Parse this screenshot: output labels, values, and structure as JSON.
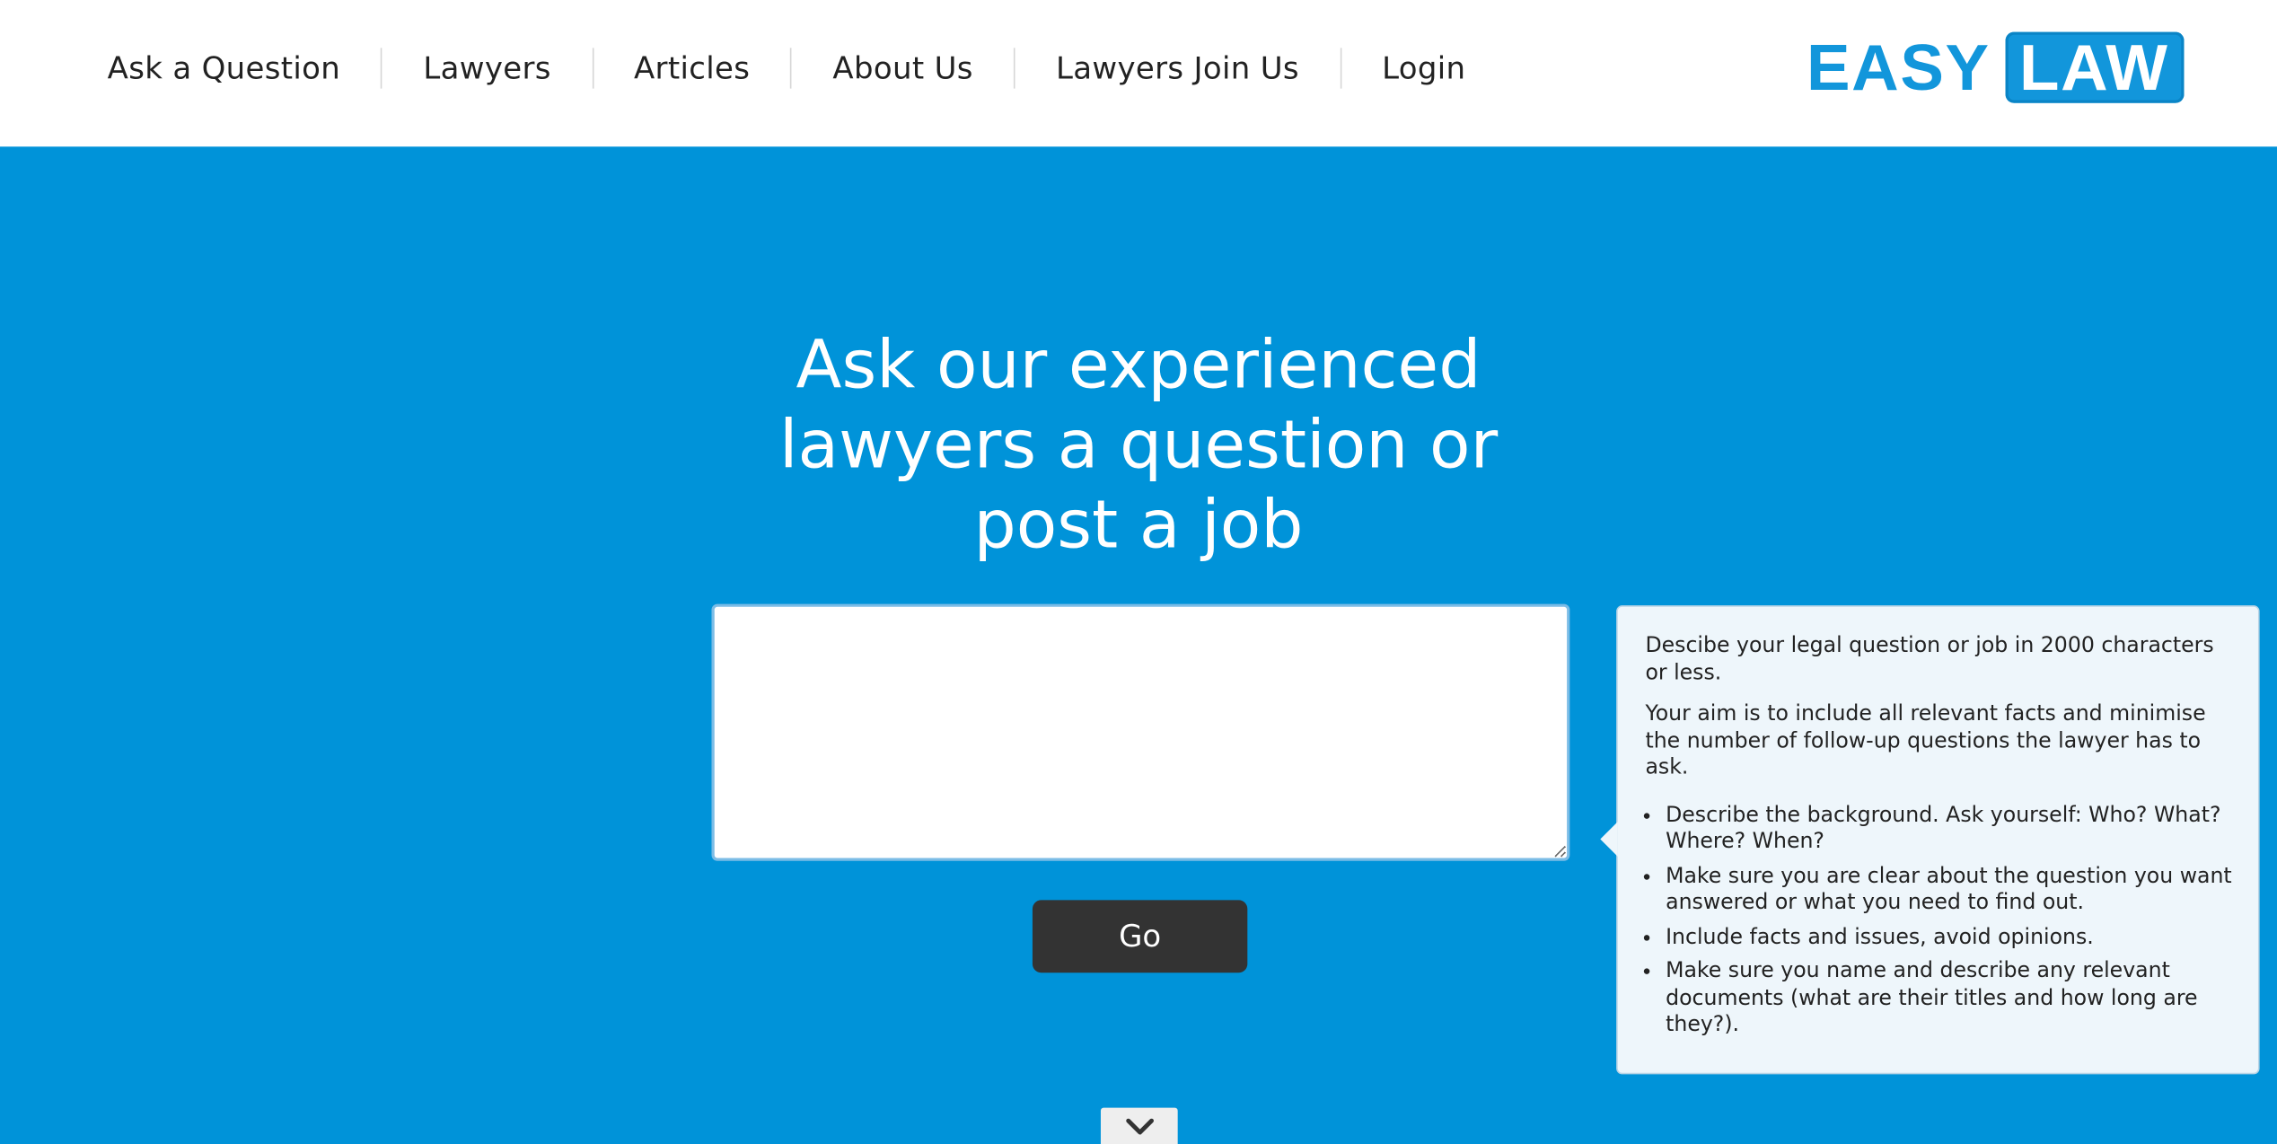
{
  "nav": {
    "items": [
      {
        "label": "Ask a Question"
      },
      {
        "label": "Lawyers"
      },
      {
        "label": "Articles"
      },
      {
        "label": "About Us"
      },
      {
        "label": "Lawyers Join Us"
      },
      {
        "label": "Login"
      }
    ]
  },
  "logo": {
    "part1": "EASY",
    "part2": "LAW"
  },
  "hero": {
    "title": "Ask our experienced lawyers a question or post a job",
    "question_value": "",
    "go_label": "Go"
  },
  "help": {
    "intro": "Descibe your legal question or job in 2000 characters or less.",
    "aim": "Your aim is to include all relevant facts and minimise the number of follow-up questions the lawyer has to ask.",
    "tips": [
      "Describe the background. Ask yourself: Who? What? Where? When?",
      "Make sure you are clear about the question you want answered or what you need to find out.",
      "Include facts and issues, avoid opinions.",
      "Make sure you name and describe any relevant documents (what are their titles and how long are they?)."
    ]
  },
  "icons": {
    "scroll": "chevron-down-icon"
  },
  "colors": {
    "hero_background": "#0093d9",
    "brand": "#1296db",
    "button": "#333333",
    "help_panel": "#eef6fb"
  }
}
